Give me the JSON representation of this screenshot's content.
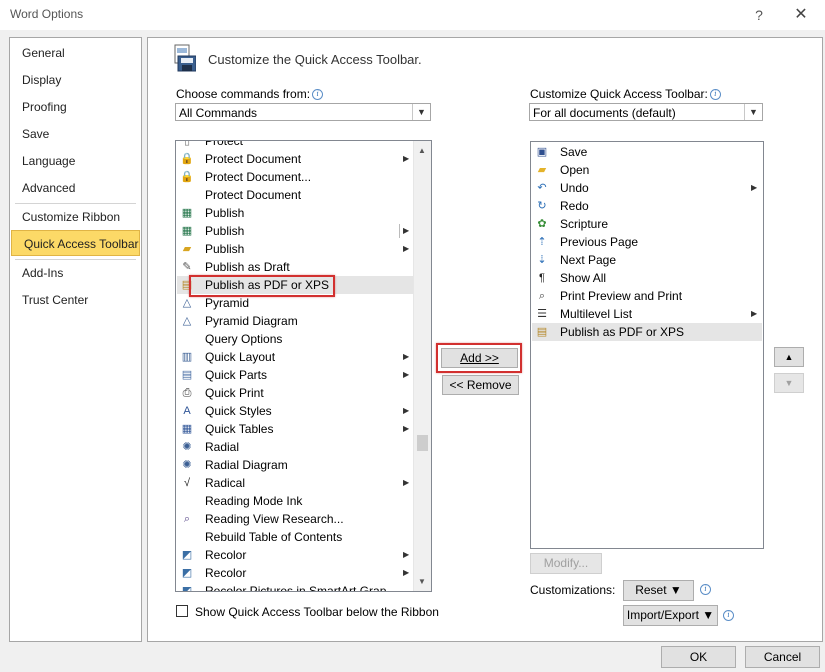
{
  "window": {
    "title": "Word Options",
    "help_glyph": "?",
    "close_glyph": "✕"
  },
  "nav": {
    "items": [
      {
        "label": "General"
      },
      {
        "label": "Display"
      },
      {
        "label": "Proofing"
      },
      {
        "label": "Save"
      },
      {
        "label": "Language"
      },
      {
        "label": "Advanced"
      },
      {
        "label": "Customize Ribbon"
      },
      {
        "label": "Quick Access Toolbar",
        "selected": true
      },
      {
        "label": "Add-Ins"
      },
      {
        "label": "Trust Center"
      }
    ]
  },
  "main": {
    "heading": "Customize the Quick Access Toolbar.",
    "choose_label": "Choose commands from:",
    "choose_value": "All Commands",
    "customize_label": "Customize Quick Access Toolbar:",
    "customize_value": "For all documents (default)",
    "commands": [
      {
        "label": "Protect",
        "icon": "doc-icon",
        "partial": true
      },
      {
        "label": "Protect Document",
        "icon": "lock-doc-icon",
        "submenu": true
      },
      {
        "label": "Protect Document...",
        "icon": "lock-doc-icon"
      },
      {
        "label": "Protect Document",
        "icon": ""
      },
      {
        "label": "Publish",
        "icon": "excel-publish-icon"
      },
      {
        "label": "Publish",
        "icon": "excel-publish-icon",
        "submenu": true,
        "split": true
      },
      {
        "label": "Publish",
        "icon": "folder-publish-icon",
        "submenu": true
      },
      {
        "label": "Publish as Draft",
        "icon": "draft-icon"
      },
      {
        "label": "Publish as PDF or XPS",
        "icon": "pdf-icon",
        "selected": true
      },
      {
        "label": "Pyramid",
        "icon": "pyramid-icon"
      },
      {
        "label": "Pyramid Diagram",
        "icon": "pyramid-icon"
      },
      {
        "label": "Query Options",
        "icon": ""
      },
      {
        "label": "Quick Layout",
        "icon": "chart-layout-icon",
        "submenu": true
      },
      {
        "label": "Quick Parts",
        "icon": "quick-parts-icon",
        "submenu": true
      },
      {
        "label": "Quick Print",
        "icon": "printer-icon"
      },
      {
        "label": "Quick Styles",
        "icon": "styles-icon",
        "submenu": true
      },
      {
        "label": "Quick Tables",
        "icon": "table-icon",
        "submenu": true
      },
      {
        "label": "Radial",
        "icon": "radial-icon"
      },
      {
        "label": "Radial Diagram",
        "icon": "radial-icon"
      },
      {
        "label": "Radical",
        "icon": "radical-icon",
        "submenu": true
      },
      {
        "label": "Reading Mode Ink",
        "icon": ""
      },
      {
        "label": "Reading View Research...",
        "icon": "research-icon"
      },
      {
        "label": "Rebuild Table of Contents",
        "icon": ""
      },
      {
        "label": "Recolor",
        "icon": "recolor-icon",
        "submenu": true
      },
      {
        "label": "Recolor",
        "icon": "recolor-icon",
        "submenu": true
      },
      {
        "label": "Recolor Pictures in SmartArt Grap",
        "icon": "recolor-icon",
        "partial": true
      }
    ],
    "toolbar_items": [
      {
        "label": "Save",
        "icon": "save-icon"
      },
      {
        "label": "Open",
        "icon": "open-folder-icon"
      },
      {
        "label": "Undo",
        "icon": "undo-icon",
        "submenu": true
      },
      {
        "label": "Redo",
        "icon": "redo-icon"
      },
      {
        "label": "Scripture",
        "icon": "scripture-icon"
      },
      {
        "label": "Previous Page",
        "icon": "previous-page-icon"
      },
      {
        "label": "Next Page",
        "icon": "next-page-icon"
      },
      {
        "label": "Show All",
        "icon": "pilcrow-icon"
      },
      {
        "label": "Print Preview and Print",
        "icon": "print-preview-icon"
      },
      {
        "label": "Multilevel List",
        "icon": "multilevel-list-icon",
        "submenu": true
      },
      {
        "label": "Publish as PDF or XPS",
        "icon": "pdf-icon",
        "selected": true
      }
    ],
    "add_button": "Add >>",
    "remove_button": "<< Remove",
    "modify_button": "Modify...",
    "customizations_label": "Customizations:",
    "reset_button": "Reset ▼",
    "import_export_button": "Import/Export ▼",
    "show_below_label": "Show Quick Access Toolbar below the Ribbon",
    "show_below_checked": false
  },
  "footer": {
    "ok": "OK",
    "cancel": "Cancel"
  },
  "colors": {
    "selected_nav": "#fcd967",
    "highlight_red": "#d2302f"
  }
}
